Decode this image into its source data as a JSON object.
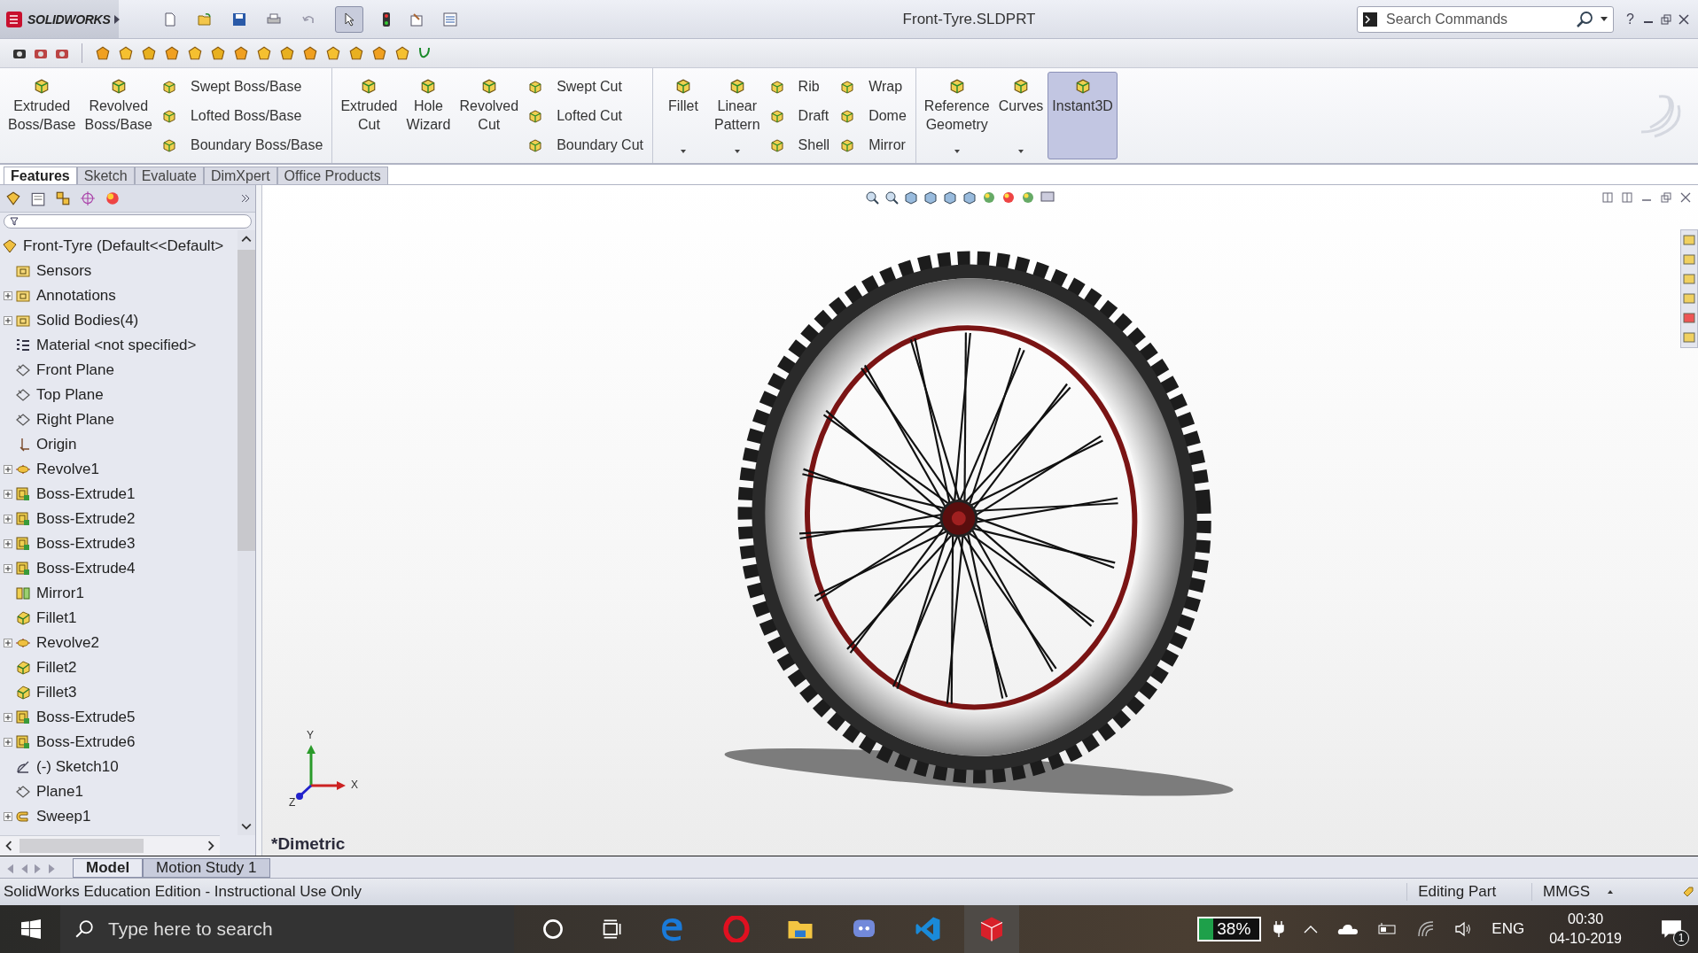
{
  "app": {
    "logo": "SOLIDWORKS",
    "title": "Front-Tyre.SLDPRT",
    "search": {
      "placeholder": "Search Commands"
    },
    "help": "?"
  },
  "ribbon": {
    "groups": [
      {
        "columns": [
          {
            "kind": "large",
            "label": "Extruded\nBoss/Base",
            "dropdown": false,
            "selected": false
          },
          {
            "kind": "large",
            "label": "Revolved\nBoss/Base",
            "dropdown": false,
            "selected": false
          },
          {
            "kind": "stack",
            "items": [
              "Swept Boss/Base",
              "Lofted Boss/Base",
              "Boundary Boss/Base"
            ]
          }
        ]
      },
      {
        "columns": [
          {
            "kind": "large",
            "label": "Extruded\nCut",
            "dropdown": false,
            "selected": false
          },
          {
            "kind": "large",
            "label": "Hole\nWizard",
            "dropdown": false,
            "selected": false
          },
          {
            "kind": "large",
            "label": "Revolved\nCut",
            "dropdown": false,
            "selected": false
          },
          {
            "kind": "stack",
            "items": [
              "Swept Cut",
              "Lofted Cut",
              "Boundary Cut"
            ]
          }
        ]
      },
      {
        "columns": [
          {
            "kind": "large",
            "label": "Fillet",
            "dropdown": true,
            "selected": false
          },
          {
            "kind": "large",
            "label": "Linear\nPattern",
            "dropdown": true,
            "selected": false
          },
          {
            "kind": "stack",
            "items": [
              "Rib",
              "Draft",
              "Shell"
            ]
          },
          {
            "kind": "stack",
            "items": [
              "Wrap",
              "Dome",
              "Mirror"
            ]
          }
        ]
      },
      {
        "columns": [
          {
            "kind": "large",
            "label": "Reference\nGeometry",
            "dropdown": true,
            "selected": false
          },
          {
            "kind": "large",
            "label": "Curves",
            "dropdown": true,
            "selected": false
          },
          {
            "kind": "large",
            "label": "Instant3D",
            "dropdown": false,
            "selected": true
          }
        ]
      }
    ]
  },
  "tabs": [
    {
      "label": "Features",
      "selected": true
    },
    {
      "label": "Sketch",
      "selected": false
    },
    {
      "label": "Evaluate",
      "selected": false
    },
    {
      "label": "DimXpert",
      "selected": false
    },
    {
      "label": "Office Products",
      "selected": false
    }
  ],
  "tree": {
    "root": "Front-Tyre  (Default<<Default>",
    "items": [
      {
        "label": "Sensors",
        "kind": "sensor",
        "expandable": false
      },
      {
        "label": "Annotations",
        "kind": "annotation",
        "expandable": true
      },
      {
        "label": "Solid Bodies(4)",
        "kind": "folder",
        "expandable": true
      },
      {
        "label": "Material <not specified>",
        "kind": "material",
        "expandable": false
      },
      {
        "label": "Front Plane",
        "kind": "plane",
        "expandable": false
      },
      {
        "label": "Top Plane",
        "kind": "plane",
        "expandable": false
      },
      {
        "label": "Right Plane",
        "kind": "plane",
        "expandable": false
      },
      {
        "label": "Origin",
        "kind": "origin",
        "expandable": false
      },
      {
        "label": "Revolve1",
        "kind": "revolve",
        "expandable": true
      },
      {
        "label": "Boss-Extrude1",
        "kind": "extrude",
        "expandable": true
      },
      {
        "label": "Boss-Extrude2",
        "kind": "extrude",
        "expandable": true
      },
      {
        "label": "Boss-Extrude3",
        "kind": "extrude",
        "expandable": true
      },
      {
        "label": "Boss-Extrude4",
        "kind": "extrude",
        "expandable": true
      },
      {
        "label": "Mirror1",
        "kind": "mirror",
        "expandable": false
      },
      {
        "label": "Fillet1",
        "kind": "fillet",
        "expandable": false
      },
      {
        "label": "Revolve2",
        "kind": "revolve",
        "expandable": true
      },
      {
        "label": "Fillet2",
        "kind": "fillet",
        "expandable": false
      },
      {
        "label": "Fillet3",
        "kind": "fillet",
        "expandable": false
      },
      {
        "label": "Boss-Extrude5",
        "kind": "extrude",
        "expandable": true
      },
      {
        "label": "Boss-Extrude6",
        "kind": "extrude",
        "expandable": true
      },
      {
        "label": "(-) Sketch10",
        "kind": "sketch",
        "expandable": false
      },
      {
        "label": "Plane1",
        "kind": "plane",
        "expandable": false
      },
      {
        "label": "Sweep1",
        "kind": "sweep",
        "expandable": true
      }
    ]
  },
  "viewport": {
    "view": "*Dimetric",
    "axes": [
      "Y",
      "X",
      "Z"
    ]
  },
  "bottom_tabs": [
    {
      "label": "Model",
      "selected": true
    },
    {
      "label": "Motion Study 1",
      "selected": false
    }
  ],
  "status_bar": {
    "message": "SolidWorks Education Edition - Instructional Use Only",
    "mode": "Editing Part",
    "units": "MMGS"
  },
  "taskbar": {
    "search": {
      "placeholder": "Type here to search"
    },
    "battery": "38%",
    "language": "ENG",
    "time": "00:30",
    "date": "04-10-2019",
    "notifications": "1"
  }
}
